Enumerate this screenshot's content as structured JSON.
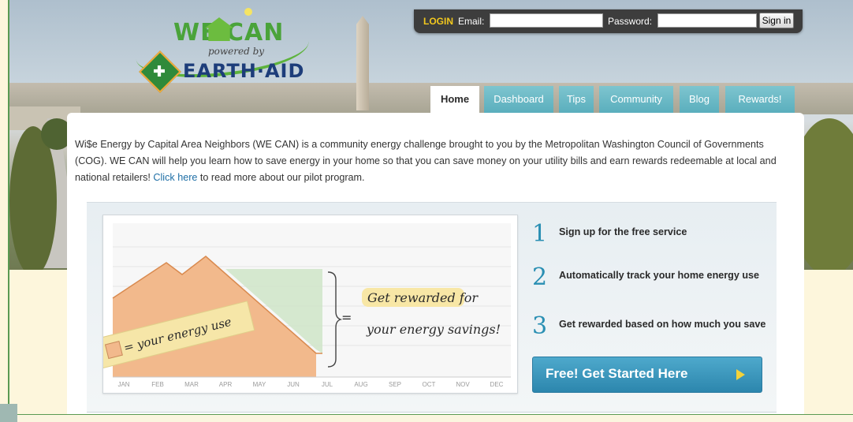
{
  "login": {
    "title": "LOGIN",
    "email_label": "Email:",
    "email_value": "",
    "password_label": "Password:",
    "password_value": "",
    "signin_label": "Sign in"
  },
  "logo": {
    "we_can": "WE CAN",
    "powered_by": "powered by",
    "earth_aid": "EARTH·AID"
  },
  "nav": {
    "tabs": [
      {
        "label": "Home",
        "active": true
      },
      {
        "label": "Dashboard"
      },
      {
        "label": "Tips"
      },
      {
        "label": "Community"
      },
      {
        "label": "Blog"
      },
      {
        "label": "Rewards!"
      }
    ]
  },
  "intro": {
    "text_before": "Wi$e Energy by Capital Area Neighbors (WE CAN) is a community energy challenge brought to you by the Metropolitan Washington Council of Governments (COG). WE CAN will help you learn how to save energy in your home so that you can save money on your utility bills and earn rewards redeemable at local and national retailers! ",
    "link_text": "Click here",
    "text_after": " to read more about our pilot program."
  },
  "promo_chart": {
    "legend": "= your energy use",
    "equals": "=",
    "caption_line1": "Get rewarded for",
    "caption_line2": "your energy savings!",
    "months": [
      "JAN",
      "FEB",
      "MAR",
      "APR",
      "MAY",
      "JUN",
      "JUL",
      "AUG",
      "SEP",
      "OCT",
      "NOV",
      "DEC"
    ]
  },
  "steps": [
    {
      "num": "1",
      "text": "Sign up for the free service"
    },
    {
      "num": "2",
      "text": "Automatically track your home energy use"
    },
    {
      "num": "3",
      "text": "Get rewarded based on how much you save"
    }
  ],
  "cta": {
    "label": "Free!  Get Started Here"
  },
  "colors": {
    "accent": "#2a8fb3",
    "tab": "#6bbcc8",
    "login_bar": "#3d3d3d",
    "energy_fill": "#f2b98c"
  }
}
